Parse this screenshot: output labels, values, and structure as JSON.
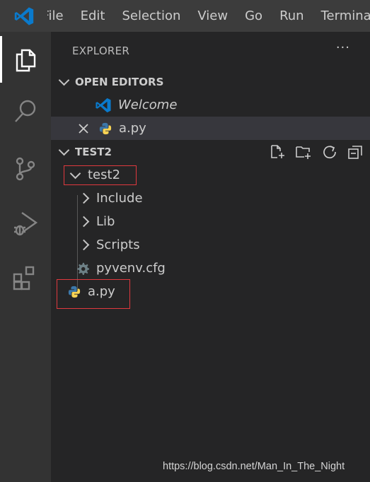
{
  "menu": [
    "File",
    "Edit",
    "Selection",
    "View",
    "Go",
    "Run",
    "Terminal"
  ],
  "activity_bar": [
    "files-icon",
    "search-icon",
    "source-control-icon",
    "run-debug-icon",
    "extensions-icon"
  ],
  "explorer": {
    "title": "EXPLORER",
    "more": "···",
    "open_editors": {
      "title": "OPEN EDITORS",
      "items": [
        {
          "label": "Welcome",
          "icon": "vscode-icon"
        },
        {
          "label": "a.py",
          "icon": "python-icon"
        }
      ]
    },
    "workspace": {
      "title": "TEST2",
      "actions": [
        "new-file-icon",
        "new-folder-icon",
        "refresh-icon",
        "collapse-all-icon"
      ],
      "tree": {
        "folder": "test2",
        "children": [
          "Include",
          "Lib",
          "Scripts",
          "pyvenv.cfg"
        ],
        "root_file": "a.py"
      }
    }
  },
  "watermark": "https://blog.csdn.net/Man_In_The_Night",
  "colors": {
    "accent": "#0078d4",
    "highlight_box": "#e0393e",
    "python_blue": "#3c78aa",
    "python_yellow": "#f7d354"
  }
}
